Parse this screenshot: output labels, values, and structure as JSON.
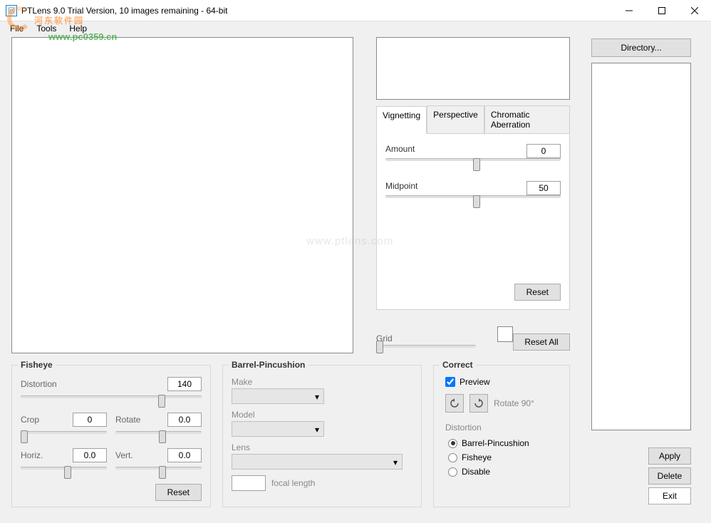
{
  "window": {
    "title": "PTLens 9.0 Trial Version, 10 images remaining - 64-bit"
  },
  "menu": {
    "file": "File",
    "tools": "Tools",
    "help": "Help"
  },
  "tabs": {
    "vignetting": "Vignetting",
    "perspective": "Perspective",
    "chromatic": "Chromatic Aberration"
  },
  "vignetting": {
    "amount_label": "Amount",
    "amount_value": "0",
    "midpoint_label": "Midpoint",
    "midpoint_value": "50",
    "reset": "Reset"
  },
  "grid": {
    "label": "Grid",
    "reset_all": "Reset All"
  },
  "fisheye": {
    "title": "Fisheye",
    "distortion_label": "Distortion",
    "distortion_value": "140",
    "crop_label": "Crop",
    "crop_value": "0",
    "rotate_label": "Rotate",
    "rotate_value": "0.0",
    "horiz_label": "Horiz.",
    "horiz_value": "0.0",
    "vert_label": "Vert.",
    "vert_value": "0.0",
    "reset": "Reset"
  },
  "barrel": {
    "title": "Barrel-Pincushion",
    "make": "Make",
    "model": "Model",
    "lens": "Lens",
    "focal": "focal length"
  },
  "correct": {
    "title": "Correct",
    "preview": "Preview",
    "rotate90": "Rotate 90°",
    "distortion_label": "Distortion",
    "opt_barrel": "Barrel-Pincushion",
    "opt_fisheye": "Fisheye",
    "opt_disable": "Disable"
  },
  "right": {
    "directory": "Directory...",
    "apply": "Apply",
    "delete": "Delete",
    "exit": "Exit"
  },
  "watermark": {
    "brand": "河东软件园",
    "url": "www.pc0359.cn",
    "center": "www.ptlens.com"
  }
}
